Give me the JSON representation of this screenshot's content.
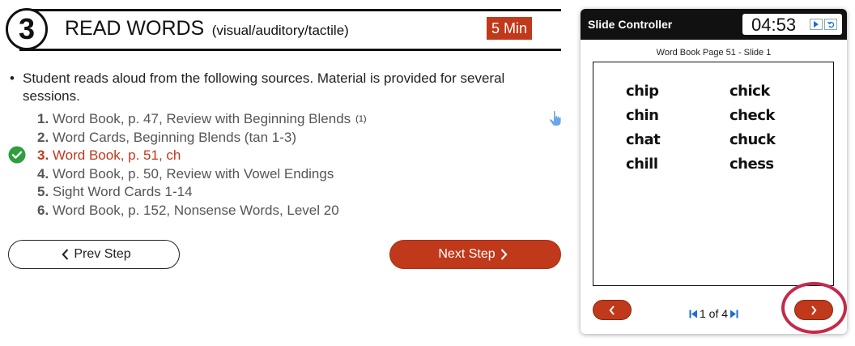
{
  "header": {
    "step_number": "3",
    "title": "READ WORDS",
    "subtitle": "(visual/auditory/tactile)",
    "duration": "5 Min"
  },
  "instruction": "Student reads aloud from the following sources. Material is provided for several sessions.",
  "sources": [
    {
      "num": "1.",
      "text": "Word Book, p. 47, Review with Beginning Blends",
      "ref": "(1)",
      "active": false
    },
    {
      "num": "2.",
      "text": "Word Cards, Beginning Blends (tan 1-3)",
      "ref": "",
      "active": false
    },
    {
      "num": "3.",
      "text": "Word Book, p. 51, ch",
      "ref": "",
      "active": true
    },
    {
      "num": "4.",
      "text": "Word Book, p. 50, Review with Vowel Endings",
      "ref": "",
      "active": false
    },
    {
      "num": "5.",
      "text": "Sight Word Cards 1-14",
      "ref": "",
      "active": false
    },
    {
      "num": "6.",
      "text": "Word Book, p. 152, Nonsense Words, Level 20",
      "ref": "",
      "active": false
    }
  ],
  "buttons": {
    "prev_label": "Prev Step",
    "next_label": "Next Step"
  },
  "controller": {
    "title": "Slide Controller",
    "timer": "04:53",
    "slide_caption": "Word Book Page 51 - Slide 1",
    "words_left": [
      "chip",
      "chin",
      "chat",
      "chill"
    ],
    "words_right": [
      "chick",
      "check",
      "chuck",
      "chess"
    ],
    "pager": "1 of 4"
  },
  "colors": {
    "accent": "#c0391b",
    "check": "#2e9e3e",
    "pager_icon": "#1a6fd1",
    "highlight_ring": "#c22b4c"
  },
  "icons": {
    "check": "check-circle-icon",
    "pointer": "hand-pointer-icon",
    "prev": "chevron-left-icon",
    "next": "chevron-right-icon",
    "play": "play-icon",
    "reset": "reset-icon",
    "first": "first-page-icon",
    "last": "last-page-icon"
  }
}
